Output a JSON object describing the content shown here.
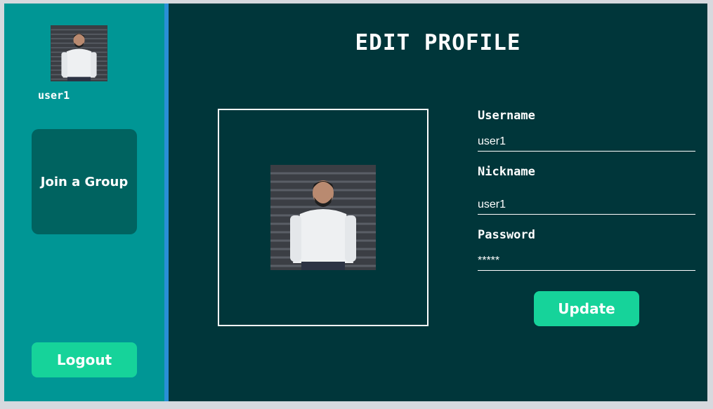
{
  "sidebar": {
    "username": "user1",
    "join_group_label": "Join a Group",
    "logout_label": "Logout"
  },
  "main": {
    "title": "EDIT PROFILE",
    "form": {
      "username_label": "Username",
      "username_value": "user1",
      "nickname_label": "Nickname",
      "nickname_value": "user1",
      "password_label": "Password",
      "password_value": "*****",
      "update_label": "Update"
    }
  },
  "colors": {
    "sidebar_bg": "#009695",
    "main_bg": "#00363a",
    "accent_button": "#16d39a",
    "card_button": "#006360",
    "divider": "#2a8fd6"
  }
}
